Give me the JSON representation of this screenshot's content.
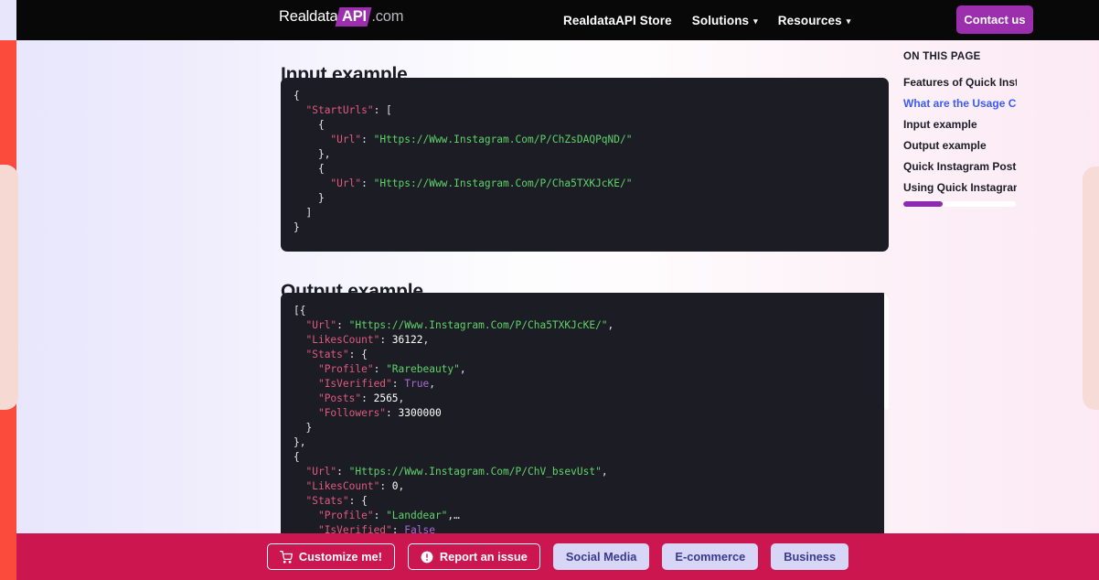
{
  "header": {
    "logo": {
      "part1": "Realdata",
      "part2": "API",
      "part3": ".com"
    },
    "nav": [
      {
        "label": "RealdataAPI Store",
        "has_caret": false
      },
      {
        "label": "Solutions",
        "has_caret": true
      },
      {
        "label": "Resources",
        "has_caret": true
      }
    ],
    "contact_label": "Contact us",
    "accent_purple": "#9b2fae",
    "bar_background": "#080808"
  },
  "main": {
    "input_heading": "Input example",
    "output_heading": "Output example",
    "input_code": [
      {
        "indent": 0,
        "tokens": [
          {
            "t": "{",
            "c": "p"
          }
        ]
      },
      {
        "indent": 1,
        "tokens": [
          {
            "t": "\"StartUrls\"",
            "c": "k"
          },
          {
            "t": ": [",
            "c": "p"
          }
        ]
      },
      {
        "indent": 2,
        "tokens": [
          {
            "t": "{",
            "c": "p"
          }
        ]
      },
      {
        "indent": 3,
        "tokens": [
          {
            "t": "\"Url\"",
            "c": "k"
          },
          {
            "t": ": ",
            "c": "p"
          },
          {
            "t": "\"Https://Www.Instagram.Com/P/ChZsDAQPqND/\"",
            "c": "s"
          }
        ]
      },
      {
        "indent": 2,
        "tokens": [
          {
            "t": "},",
            "c": "p"
          }
        ]
      },
      {
        "indent": 2,
        "tokens": [
          {
            "t": "{",
            "c": "p"
          }
        ]
      },
      {
        "indent": 3,
        "tokens": [
          {
            "t": "\"Url\"",
            "c": "k"
          },
          {
            "t": ": ",
            "c": "p"
          },
          {
            "t": "\"Https://Www.Instagram.Com/P/Cha5TXKJcKE/\"",
            "c": "s"
          }
        ]
      },
      {
        "indent": 2,
        "tokens": [
          {
            "t": "}",
            "c": "p"
          }
        ]
      },
      {
        "indent": 1,
        "tokens": [
          {
            "t": "]",
            "c": "p"
          }
        ]
      },
      {
        "indent": 0,
        "tokens": [
          {
            "t": "}",
            "c": "p"
          }
        ]
      }
    ],
    "output_code": [
      {
        "indent": 0,
        "tokens": [
          {
            "t": "[{",
            "c": "p"
          }
        ]
      },
      {
        "indent": 1,
        "tokens": [
          {
            "t": "\"Url\"",
            "c": "k"
          },
          {
            "t": ": ",
            "c": "p"
          },
          {
            "t": "\"Https://Www.Instagram.Com/P/Cha5TXKJcKE/\"",
            "c": "s"
          },
          {
            "t": ",",
            "c": "p"
          }
        ]
      },
      {
        "indent": 1,
        "tokens": [
          {
            "t": "\"LikesCount\"",
            "c": "k"
          },
          {
            "t": ": ",
            "c": "p"
          },
          {
            "t": "36122",
            "c": "n"
          },
          {
            "t": ",",
            "c": "p"
          }
        ]
      },
      {
        "indent": 1,
        "tokens": [
          {
            "t": "\"Stats\"",
            "c": "k"
          },
          {
            "t": ": {",
            "c": "p"
          }
        ]
      },
      {
        "indent": 2,
        "tokens": [
          {
            "t": "\"Profile\"",
            "c": "k"
          },
          {
            "t": ": ",
            "c": "p"
          },
          {
            "t": "\"Rarebeauty\"",
            "c": "s"
          },
          {
            "t": ",",
            "c": "p"
          }
        ]
      },
      {
        "indent": 2,
        "tokens": [
          {
            "t": "\"IsVerified\"",
            "c": "k"
          },
          {
            "t": ": ",
            "c": "p"
          },
          {
            "t": "True",
            "c": "b"
          },
          {
            "t": ",",
            "c": "p"
          }
        ]
      },
      {
        "indent": 2,
        "tokens": [
          {
            "t": "\"Posts\"",
            "c": "k"
          },
          {
            "t": ": ",
            "c": "p"
          },
          {
            "t": "2565",
            "c": "n"
          },
          {
            "t": ",",
            "c": "p"
          }
        ]
      },
      {
        "indent": 2,
        "tokens": [
          {
            "t": "\"Followers\"",
            "c": "k"
          },
          {
            "t": ": ",
            "c": "p"
          },
          {
            "t": "3300000",
            "c": "n"
          }
        ]
      },
      {
        "indent": 1,
        "tokens": [
          {
            "t": "}",
            "c": "p"
          }
        ]
      },
      {
        "indent": 0,
        "tokens": [
          {
            "t": "},",
            "c": "p"
          }
        ]
      },
      {
        "indent": 0,
        "tokens": [
          {
            "t": "{",
            "c": "p"
          }
        ]
      },
      {
        "indent": 1,
        "tokens": [
          {
            "t": "\"Url\"",
            "c": "k"
          },
          {
            "t": ": ",
            "c": "p"
          },
          {
            "t": "\"Https://Www.Instagram.Com/P/ChV_bsevUst\"",
            "c": "s"
          },
          {
            "t": ",",
            "c": "p"
          }
        ]
      },
      {
        "indent": 1,
        "tokens": [
          {
            "t": "\"LikesCount\"",
            "c": "k"
          },
          {
            "t": ": ",
            "c": "p"
          },
          {
            "t": "0",
            "c": "n"
          },
          {
            "t": ",",
            "c": "p"
          }
        ]
      },
      {
        "indent": 1,
        "tokens": [
          {
            "t": "\"Stats\"",
            "c": "k"
          },
          {
            "t": ": {",
            "c": "p"
          }
        ]
      },
      {
        "indent": 2,
        "tokens": [
          {
            "t": "\"Profile\"",
            "c": "k"
          },
          {
            "t": ": ",
            "c": "p"
          },
          {
            "t": "\"Landdear\"",
            "c": "s"
          },
          {
            "t": ",…",
            "c": "p"
          }
        ]
      },
      {
        "indent": 2,
        "tokens": [
          {
            "t": "\"IsVerified\"",
            "c": "k"
          },
          {
            "t": ": ",
            "c": "p"
          },
          {
            "t": "False",
            "c": "b"
          }
        ]
      }
    ]
  },
  "toc": {
    "title": "ON THIS PAGE",
    "items": [
      {
        "label": "Features of Quick Instagra",
        "active": false
      },
      {
        "label": "What are the Usage Costs",
        "active": true
      },
      {
        "label": "Input example",
        "active": false
      },
      {
        "label": "Output example",
        "active": false
      },
      {
        "label": "Quick Instagram Posts Scr",
        "active": false
      },
      {
        "label": "Using Quick Instagram Po",
        "active": false
      }
    ],
    "progress_percent": 35,
    "active_color": "#3b5bfd",
    "progress_color": "#8d2bb0"
  },
  "actionbar": {
    "background": "#cc164f",
    "buttons": [
      {
        "label": "Customize me!",
        "icon": "shopping-cart-icon",
        "style": "outline"
      },
      {
        "label": "Report an issue",
        "icon": "alert-circle-icon",
        "style": "outline"
      },
      {
        "label": "Social Media",
        "icon": "",
        "style": "light"
      },
      {
        "label": "E-commerce",
        "icon": "",
        "style": "light"
      },
      {
        "label": "Business",
        "icon": "",
        "style": "light"
      }
    ]
  }
}
